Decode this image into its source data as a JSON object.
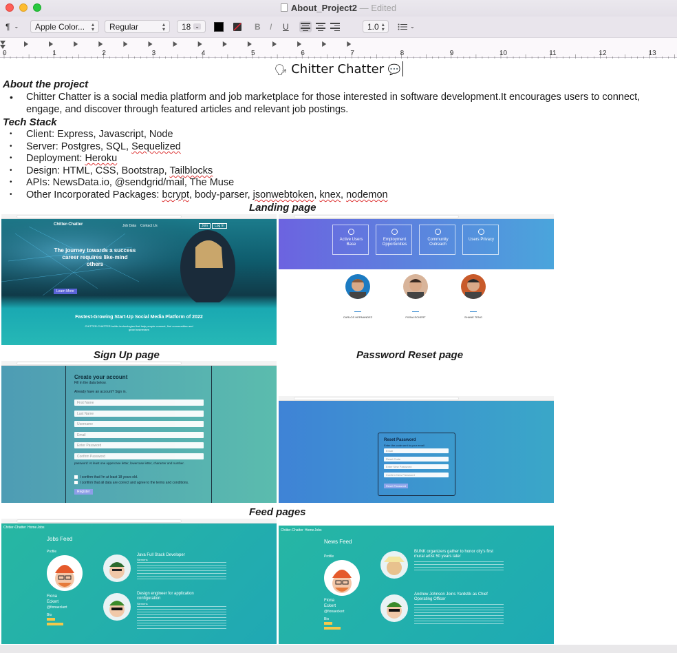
{
  "window": {
    "title": "About_Project2",
    "status": "Edited"
  },
  "toolbar": {
    "paragraph_symbol": "¶",
    "font_family": "Apple Color...",
    "typeface": "Regular",
    "font_size": "18",
    "bold": "B",
    "italic": "I",
    "underline": "U",
    "line_spacing": "1.0",
    "colors": {
      "text": "#000000"
    }
  },
  "ruler": {
    "labels": [
      "0",
      "1",
      "2",
      "3",
      "4",
      "5",
      "6",
      "7",
      "8",
      "9",
      "10",
      "11",
      "12",
      "13"
    ]
  },
  "document": {
    "title": "Chitter Chatter",
    "title_emoji_left": "🗣",
    "title_emoji_right": "💬",
    "about_heading": "About the project",
    "about_text": "Chitter Chatter is a social media platform and job marketplace for those interested in software development.It encourages users to connect, engage, and discover through featured articles and relevant job postings.",
    "tech_heading": "Tech Stack",
    "tech_items": [
      {
        "label": "Client: ",
        "plain": "Express, Javascript, Node",
        "marked": ""
      },
      {
        "label": "Server: ",
        "plain": "Postgres, SQL, ",
        "marked": "Sequelized"
      },
      {
        "label": "Deployment: ",
        "plain": "",
        "marked": "Heroku"
      },
      {
        "label": "Design: ",
        "plain": "HTML, CSS, Bootstrap, ",
        "marked": "Tailblocks"
      },
      {
        "label": "APIs: ",
        "plain": "NewsData.io, @sendgrid/mail, The Muse",
        "marked": ""
      },
      {
        "label": "Other Incorporated Packages: ",
        "plain": "",
        "marked": ""
      }
    ],
    "packages": [
      "bcrypt",
      ", body-parser, ",
      "jsonwebtoken",
      ", ",
      "knex",
      ", ",
      "nodemon"
    ],
    "captions": {
      "landing": "Landing page",
      "signup": "Sign Up page",
      "reset": "Password Reset page",
      "feed": "Feed pages"
    }
  },
  "screens": {
    "landing": {
      "brand": "Chitter-Chatter",
      "nav": [
        "Job Data",
        "Contact Us"
      ],
      "buttons": [
        "Join",
        "Log In"
      ],
      "hero": "The journey towards a success career requires like-mind others",
      "learn": "Learn More",
      "banner": "Fastest-Growing Start-Up Social Media Platform of 2022",
      "banner_sub": "CHITTER-CHATTER builds technologies that help people connect, find communities and grow businesses"
    },
    "stats": {
      "cards": [
        "Active Users Base",
        "Employment Opportunities",
        "Community Outreach",
        "Users Privacy"
      ],
      "team": [
        "CARLOS HERNANDEZ",
        "FIONA ECKERT",
        "SHANE TENG"
      ]
    },
    "signup": {
      "heading": "Create your account",
      "sub": "Fill in the data below.",
      "have": "Already have an account? Sign in.",
      "fields": [
        "First Name",
        "Last Name",
        "Username",
        "Email",
        "Enter Password",
        "Confirm Password"
      ],
      "hint": "password: At least one uppercase letter, lowercase letter, character and number.",
      "check1": "I confirm that I'm at least 18 years old.",
      "check2": "I confirm that all data are correct and agree to the terms and conditions.",
      "submit": "Register"
    },
    "reset": {
      "heading": "Reset Password",
      "sub": "Enter the code sent to your email",
      "fields": [
        "Email",
        "Reset Code",
        "Enter New Password",
        "Confirm New Password"
      ],
      "submit": "Reset Password"
    },
    "jobs": {
      "brand": "Chitter-Chatter",
      "nav": [
        "Home",
        "Jobs"
      ],
      "heading": "Jobs Feed",
      "profile": "Profile",
      "first": "Fiona",
      "last": "Eckert",
      "handle": "@fionaeckert",
      "bio": "Bio",
      "post1_title": "Java Full Stack Developer",
      "post1_company": "Siemens",
      "post2_title": "Design engineer for application configuration",
      "post2_company": "Siemens"
    },
    "news": {
      "brand": "Chitter-Chatter",
      "nav": [
        "Home",
        "Jobs"
      ],
      "heading": "News Feed",
      "profile": "Profile",
      "first": "Fiona",
      "last": "Eckert",
      "handle": "@fionaeckert",
      "bio": "Bio",
      "post1_title": "BUNK organizers gather to honor city's first mural artist 50 years later",
      "post2_title": "Andrew Johnson Joins Yardstik as Chief Operating Officer"
    }
  }
}
